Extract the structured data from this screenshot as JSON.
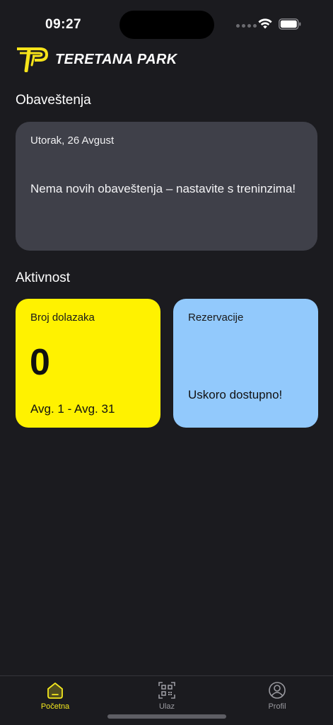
{
  "status": {
    "time": "09:27"
  },
  "header": {
    "brand_name": "TERETANA PARK"
  },
  "notifications": {
    "section_title": "Obaveštenja",
    "date": "Utorak, 26 Avgust",
    "message": "Nema novih obaveštenja – nastavite s treninzima!"
  },
  "activity": {
    "section_title": "Aktivnost",
    "visits_card": {
      "label": "Broj dolazaka",
      "count": "0",
      "range": "Avg. 1 - Avg. 31"
    },
    "reservations_card": {
      "label": "Rezervacije",
      "status": "Uskoro dostupno!"
    }
  },
  "tab_bar": {
    "tabs": [
      {
        "label": "Početna",
        "icon": "home-icon",
        "active": true
      },
      {
        "label": "Ulaz",
        "icon": "qr-code-icon",
        "active": false
      },
      {
        "label": "Profil",
        "icon": "profile-icon",
        "active": false
      }
    ]
  },
  "colors": {
    "background": "#1b1b1f",
    "card_dark": "#3f4049",
    "accent_yellow": "#fff200",
    "accent_blue": "#92c9fc",
    "active_tab": "#f4e81e"
  }
}
